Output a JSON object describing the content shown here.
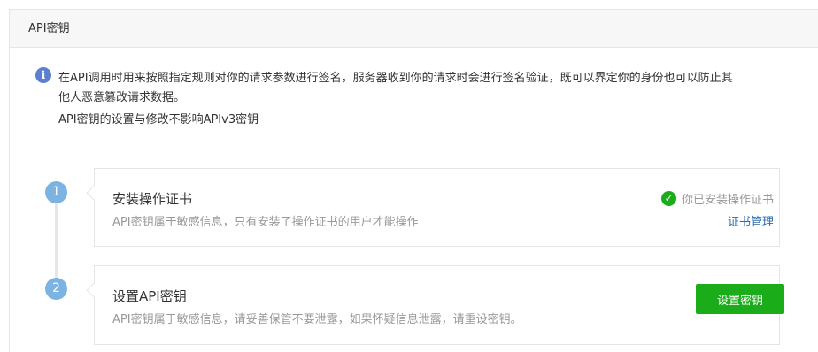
{
  "panel": {
    "title": "API密钥"
  },
  "notice": {
    "icon": "info-icon",
    "line1": "在API调用时用来按照指定规则对你的请求参数进行签名，服务器收到你的请求时会进行签名验证，既可以界定你的身份也可以防止其",
    "line2": "他人恶意篡改请求数据。",
    "line3": "API密钥的设置与修改不影响APIv3密钥"
  },
  "steps": [
    {
      "number": "1",
      "title": "安装操作证书",
      "desc": "API密钥属于敏感信息，只有安装了操作证书的用户才能操作",
      "status_text": "你已安装操作证书",
      "status_icon": "check-circle-icon",
      "link_label": "证书管理"
    },
    {
      "number": "2",
      "title": "设置API密钥",
      "desc": "API密钥属于敏感信息，请妥善保管不要泄露，如果怀疑信息泄露，请重设密钥。",
      "button_label": "设置密钥"
    }
  ],
  "colors": {
    "accent_green": "#1aad19",
    "step_blue": "#7bb3e3",
    "link_blue": "#2b6db0"
  }
}
